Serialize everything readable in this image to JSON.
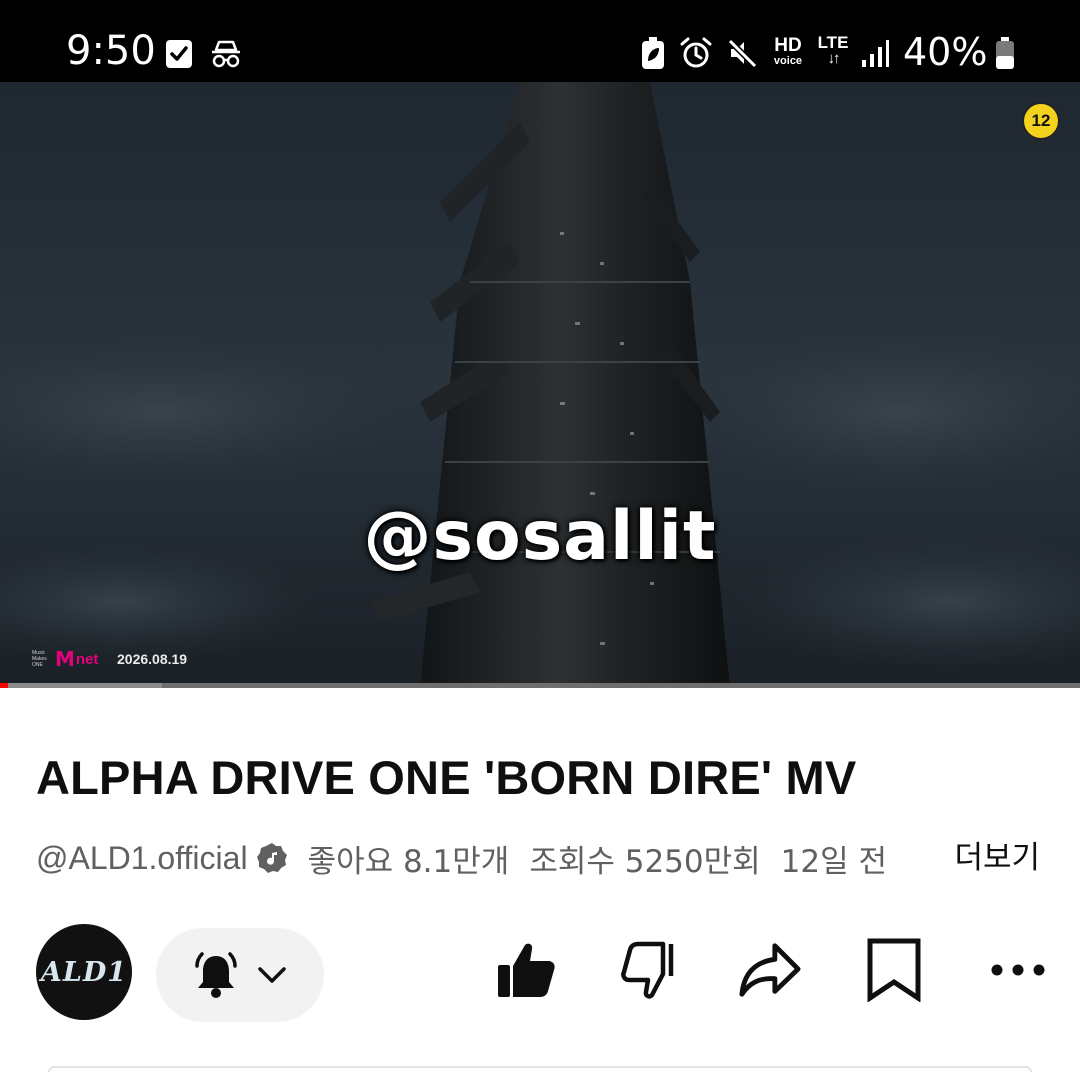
{
  "status_bar": {
    "time": "9:50",
    "icons": [
      "checkbox-notification-icon",
      "incognito-icon",
      "battery-saver-icon",
      "alarm-icon",
      "mute-icon",
      "hd-voice-icon",
      "lte-icon",
      "signal-icon",
      "battery-icon"
    ],
    "hd_label": "HD",
    "voice_label": "voice",
    "lte_label": "LTE",
    "battery_percent": "40%"
  },
  "video": {
    "age_rating": "12",
    "watermark": "@sosallit",
    "broadcaster_tagline": "Music Makes ONE",
    "broadcaster_logo_m": "M",
    "broadcaster_logo_net": "net",
    "date": "2026.08.19",
    "progress": 0.15
  },
  "info": {
    "title": "ALPHA DRIVE ONE 'BORN DIRE' MV",
    "channel": "@ALD1.official",
    "likes": "좋아요 8.1만개",
    "views": "조회수 5250만회",
    "age": "12일 전",
    "more": "더보기"
  },
  "channel_avatar": {
    "text": "ALD1"
  },
  "actions": [
    "bell-icon",
    "chevron-down-icon",
    "like-icon",
    "dislike-icon",
    "share-icon",
    "save-icon",
    "more-icon"
  ],
  "colors": {
    "accent_red": "#ff0000",
    "mnet_pink": "#e6007e",
    "age_badge": "#f2d21c"
  }
}
